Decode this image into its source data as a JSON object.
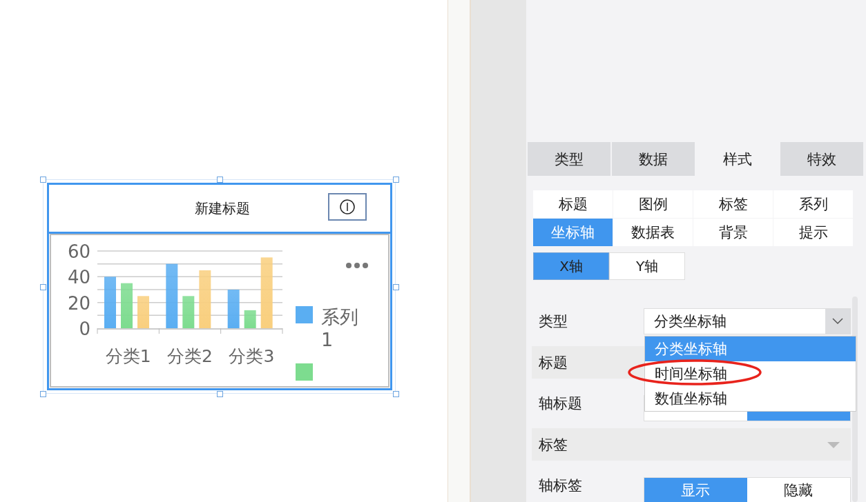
{
  "canvas": {
    "widget": {
      "title": "新建标题",
      "chart_data": {
        "type": "bar",
        "categories": [
          "分类1",
          "分类2",
          "分类3"
        ],
        "ylim": [
          0,
          60
        ],
        "yticks": [
          0,
          20,
          40,
          60
        ],
        "series": [
          {
            "color": "#5aaef2",
            "values": [
              40,
              50,
              30
            ]
          },
          {
            "color": "#7ddc8f",
            "values": [
              35,
              25,
              14
            ]
          },
          {
            "color": "#f9cf7e",
            "values": [
              25,
              45,
              55
            ]
          }
        ]
      },
      "legend": [
        {
          "label": "系列1",
          "color": "#5aaef2"
        },
        {
          "color": "#7ddc8f"
        }
      ]
    }
  },
  "panel": {
    "tabs": [
      {
        "label": "类型",
        "selected": false
      },
      {
        "label": "数据",
        "selected": false
      },
      {
        "label": "样式",
        "selected": true
      },
      {
        "label": "特效",
        "selected": false
      }
    ],
    "subtabs": [
      {
        "label": "标题",
        "selected": false
      },
      {
        "label": "图例",
        "selected": false
      },
      {
        "label": "标签",
        "selected": false
      },
      {
        "label": "系列",
        "selected": false
      },
      {
        "label": "坐标轴",
        "selected": true
      },
      {
        "label": "数据表",
        "selected": false
      },
      {
        "label": "背景",
        "selected": false
      },
      {
        "label": "提示",
        "selected": false
      }
    ],
    "axis_tabs": [
      {
        "label": "X轴",
        "selected": true
      },
      {
        "label": "Y轴",
        "selected": false
      }
    ],
    "rows": [
      {
        "kind": "select",
        "label": "类型",
        "value": "分类坐标轴",
        "expanded": true,
        "options": [
          {
            "label": "分类坐标轴",
            "selected": true
          },
          {
            "label": "时间坐标轴",
            "selected": false
          },
          {
            "label": "数值坐标轴",
            "selected": false
          }
        ]
      },
      {
        "kind": "section",
        "label": "标题"
      },
      {
        "kind": "toggle",
        "label": "轴标题",
        "options": [
          {
            "selected": false
          },
          {
            "selected": true
          }
        ]
      },
      {
        "kind": "section",
        "label": "标签",
        "collapsed": true
      },
      {
        "kind": "toggle",
        "label": "轴标签",
        "options": [
          {
            "label": "显示",
            "selected": true
          },
          {
            "label": "隐藏",
            "selected": false
          }
        ]
      }
    ]
  },
  "highlight": {
    "kind": "ellipse"
  }
}
